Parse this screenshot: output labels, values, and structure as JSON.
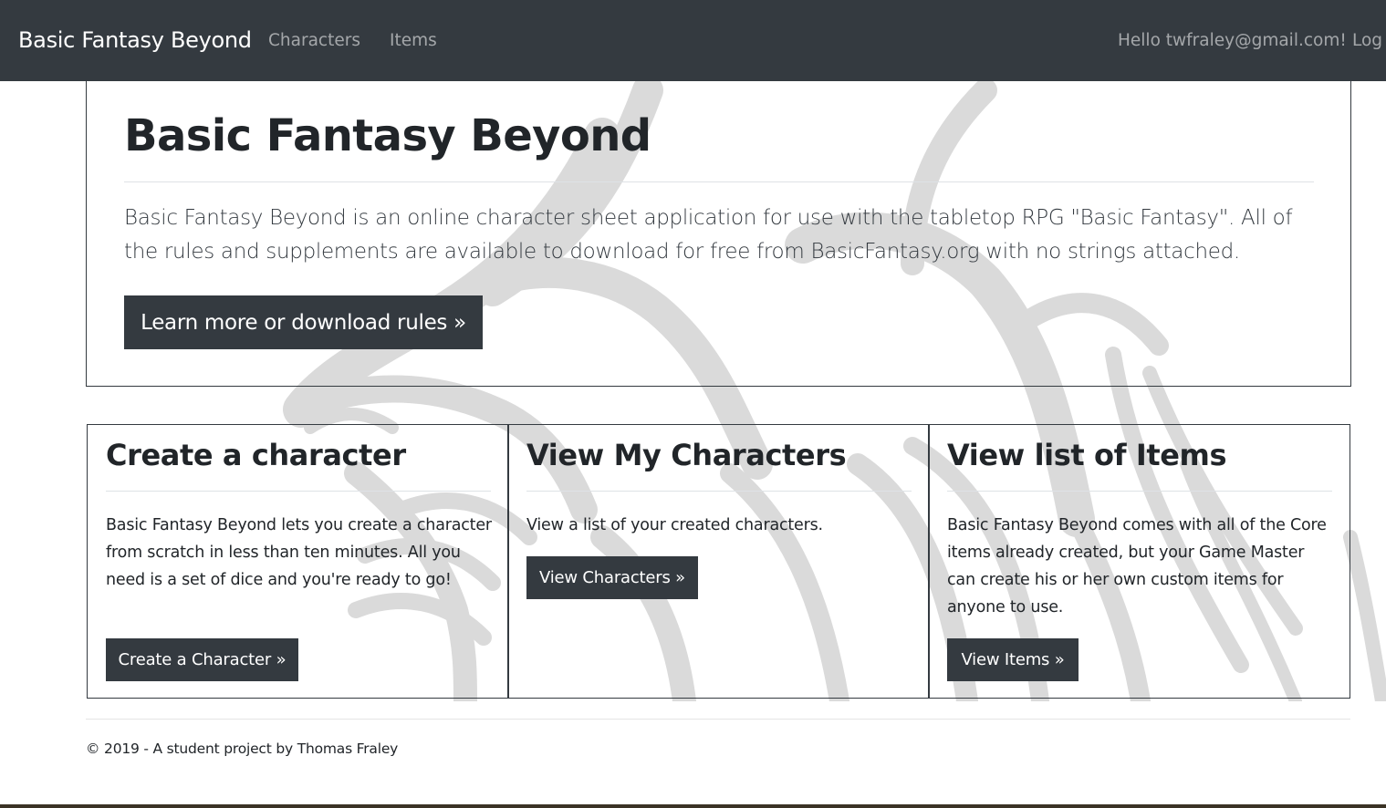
{
  "navbar": {
    "brand": "Basic Fantasy Beyond",
    "links": [
      "Characters",
      "Items"
    ],
    "greeting": "Hello twfraley@gmail.com!",
    "logout": "Log"
  },
  "jumbotron": {
    "title": "Basic Fantasy Beyond",
    "lead": "Basic Fantasy Beyond is an online character sheet application for use with the tabletop RPG \"Basic Fantasy\". All of the rules and supplements are available to download for free from BasicFantasy.org with no strings attached.",
    "button": "Learn more or download rules »"
  },
  "cards": [
    {
      "title": "Create a character",
      "text": "Basic Fantasy Beyond lets you create a character from scratch in less than ten minutes. All you need is a set of dice and you're ready to go!",
      "button": "Create a Character »"
    },
    {
      "title": "View My Characters",
      "text": "View a list of your created characters.",
      "button": "View Characters »"
    },
    {
      "title": "View list of Items",
      "text": "Basic Fantasy Beyond comes with all of the Core items already created, but your Game Master can create his or her own custom items for anyone to use.",
      "button": "View Items »"
    }
  ],
  "footer": {
    "text": "© 2019 - A student project by Thomas Fraley"
  },
  "colors": {
    "navbar": "#343a40",
    "button": "#343a40",
    "watermark": "#d9d9d9"
  }
}
